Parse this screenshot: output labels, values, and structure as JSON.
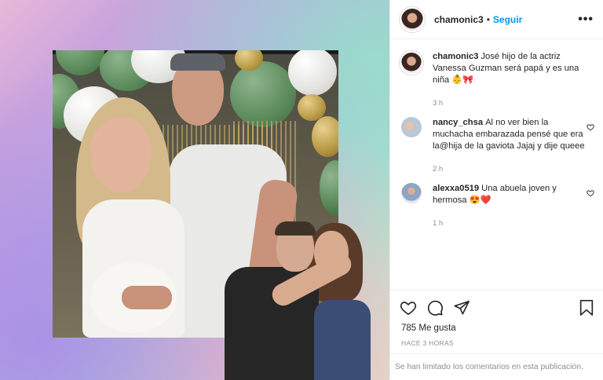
{
  "post": {
    "author": "chamonic3",
    "separator": "•",
    "follow_label": "Seguir",
    "more_icon": "more-horizontal-icon",
    "caption": "José hijo de la actriz Vanessa Guzman será papá y es una niña 👶🎀",
    "caption_time": "3 h"
  },
  "comments": [
    {
      "user": "nancy_chsa",
      "text": "Al no ver bien la muchacha embarazada pensé que era la@hija de la gaviota Jajaj y dije queee",
      "time": "2 h",
      "like_icon": "heart-outline-icon"
    },
    {
      "user": "alexxa0519",
      "text": "Una abuela joven y hermosa 😍❤️",
      "time": "1 h",
      "like_icon": "heart-outline-icon"
    }
  ],
  "actions": {
    "like_icon": "heart-icon",
    "comment_icon": "comment-icon",
    "share_icon": "paper-plane-icon",
    "save_icon": "bookmark-icon"
  },
  "likes": "785 Me gusta",
  "posted_ago": "HACE 3 HORAS",
  "comments_limited": "Se han limitado los comentarios en esta publicación.",
  "colors": {
    "follow": "#0095f6",
    "text": "#262626",
    "muted": "#8e8e8e",
    "divider": "#efefef"
  }
}
